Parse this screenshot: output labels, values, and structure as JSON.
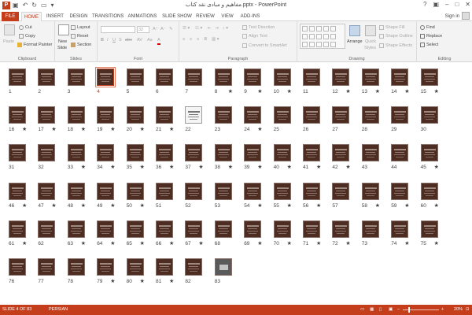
{
  "window": {
    "title": "مفاهیم و مبادی نقد کتاب.pptx - PowerPoint",
    "app_icon": "P",
    "qat_icons": [
      "save-icon",
      "undo-icon",
      "redo-icon",
      "slideshow-from-start-icon",
      "customize-qat-icon"
    ],
    "controls": [
      "?",
      "▣",
      "–",
      "□",
      "✕"
    ]
  },
  "tabs": {
    "items": [
      "FILE",
      "HOME",
      "INSERT",
      "DESIGN",
      "TRANSITIONS",
      "ANIMATIONS",
      "SLIDE SHOW",
      "REVIEW",
      "VIEW",
      "ADD-INS"
    ],
    "active": "HOME",
    "signin": "Sign in"
  },
  "ribbon": {
    "clipboard": {
      "paste": "Paste",
      "cut": "Cut",
      "copy": "Copy",
      "format_painter": "Format Painter",
      "label": "Clipboard"
    },
    "slides": {
      "new_slide_1": "New",
      "new_slide_2": "Slide",
      "layout": "Layout",
      "reset": "Reset",
      "section": "Section",
      "label": "Slides"
    },
    "font": {
      "size": "32",
      "bold": "B",
      "italic": "I",
      "underline": "U",
      "strike": "S",
      "shadow": "abc",
      "spacing": "AV",
      "case": "Aa",
      "color": "A",
      "label": "Font"
    },
    "paragraph": {
      "text_direction": "Text Direction",
      "align_text": "Align Text",
      "smartart": "Convert to SmartArt",
      "label": "Paragraph"
    },
    "drawing": {
      "arrange": "Arrange",
      "quick_styles_1": "Quick",
      "quick_styles_2": "Styles",
      "shape_fill": "Shape Fill",
      "shape_outline": "Shape Outline",
      "shape_effects": "Shape Effects",
      "label": "Drawing"
    },
    "editing": {
      "find": "Find",
      "replace": "Replace",
      "select": "Select",
      "label": "Editing"
    }
  },
  "slides": {
    "selected": 4,
    "doc_slide": 22,
    "image_slide": 83,
    "numbers": [
      "1",
      "2",
      "3",
      "4",
      "5",
      "6",
      "7",
      "8",
      "9",
      "10",
      "11",
      "12",
      "13",
      "14",
      "15",
      "16",
      "17",
      "18",
      "19",
      "20",
      "21",
      "22",
      "23",
      "24",
      "25",
      "26",
      "27",
      "28",
      "29",
      "30",
      "31",
      "32",
      "33",
      "34",
      "35",
      "36",
      "37",
      "38",
      "39",
      "40",
      "41",
      "42",
      "43",
      "44",
      "45",
      "46",
      "47",
      "48",
      "49",
      "50",
      "51",
      "52",
      "53",
      "54",
      "55",
      "56",
      "57",
      "58",
      "59",
      "60",
      "61",
      "62",
      "63",
      "64",
      "65",
      "66",
      "67",
      "68",
      "69",
      "70",
      "71",
      "72",
      "73",
      "74",
      "75",
      "76",
      "77",
      "78",
      "79",
      "80",
      "81",
      "82",
      "83"
    ],
    "starred": [
      8,
      9,
      10,
      12,
      13,
      14,
      15,
      16,
      17,
      18,
      19,
      20,
      21,
      24,
      33,
      34,
      35,
      36,
      37,
      38,
      39,
      40,
      41,
      42,
      45,
      46,
      47,
      48,
      49,
      50,
      54,
      55,
      56,
      58,
      59,
      60,
      61,
      63,
      64,
      65,
      66,
      67,
      69,
      70,
      71,
      72,
      74,
      75,
      79,
      80,
      81
    ],
    "star_char": "★"
  },
  "statusbar": {
    "slide_info": "SLIDE 4 OF 83",
    "language": "PERSIAN",
    "minus": "–",
    "plus": "+",
    "zoom": "20%",
    "zoom_value": 20
  },
  "colors": {
    "accent": "#c43e1c",
    "thumb_bg": "#4d2c22"
  }
}
